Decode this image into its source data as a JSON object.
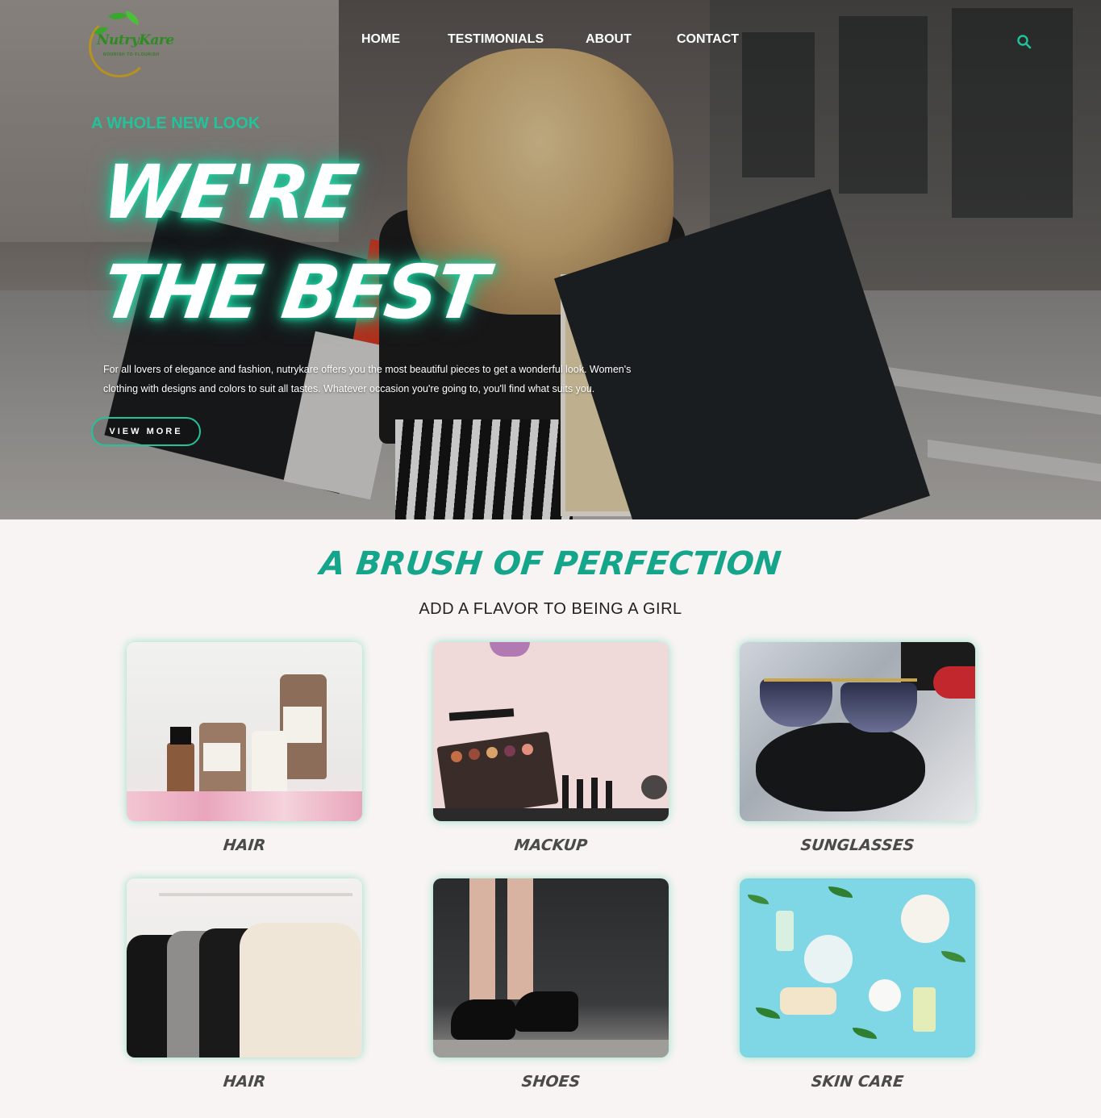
{
  "brand": {
    "logo_text": "NutryKare",
    "tagline": "NOURISH TO FLOURISH"
  },
  "nav": {
    "items": [
      "HOME",
      "TESTIMONIALS",
      "ABOUT",
      "CONTACT"
    ],
    "search_icon": "search-icon"
  },
  "hero": {
    "eyebrow": "A WHOLE NEW LOOK",
    "headline_line1": "WE'RE",
    "headline_line2": "THE BEST",
    "description": "For all lovers of elegance and fashion, nutrykare offers you the most beautiful pieces to get a wonderful look. Women's clothing with designs and colors to suit all tastes. Whatever occasion you're going to, you'll find what suits you.",
    "cta_label": "VIEW MORE"
  },
  "section": {
    "title": "A BRUSH OF PERFECTION",
    "subtitle": "ADD A FLAVOR TO BEING A GIRL"
  },
  "categories": [
    {
      "label": "HAIR"
    },
    {
      "label": "MACKUP"
    },
    {
      "label": "SUNGLASSES"
    },
    {
      "label": "HAIR"
    },
    {
      "label": "SHOES"
    },
    {
      "label": "SKIN CARE"
    }
  ],
  "colors": {
    "accent": "#21c39a",
    "title_teal": "#14a58a",
    "page_bg": "#f7f4f3"
  }
}
